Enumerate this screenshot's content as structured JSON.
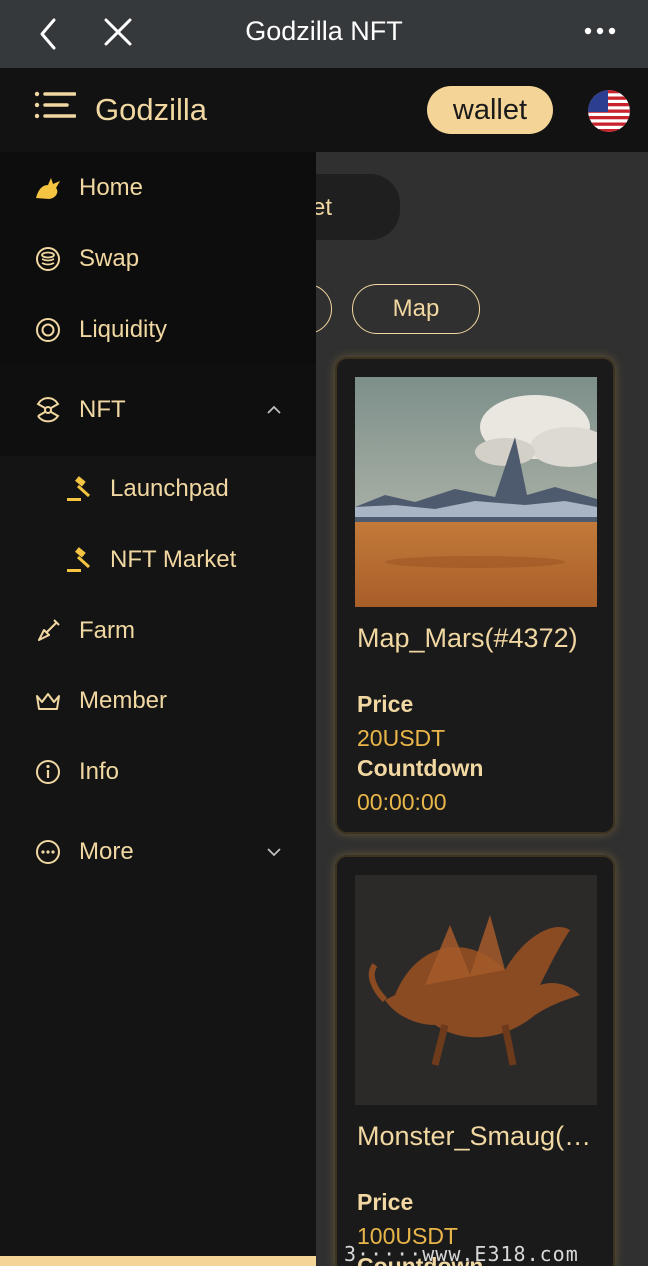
{
  "browser": {
    "title": "Godzilla NFT"
  },
  "header": {
    "brand": "Godzilla",
    "wallet_label": "wallet",
    "language_flag": "us-flag-icon"
  },
  "content": {
    "tab_partial": "ket",
    "filters": [
      {
        "label": ""
      },
      {
        "label": "Map"
      }
    ],
    "cards": [
      {
        "name": "Map_Mars(#4372)",
        "price_label": "Price",
        "price": "20USDT",
        "countdown_label": "Countdown",
        "countdown": "00:00:00"
      },
      {
        "name": "Monster_Smaug(…",
        "price_label": "Price",
        "price": "100USDT",
        "countdown_label": "Countdown"
      }
    ]
  },
  "drawer": {
    "items": [
      {
        "label": "Home",
        "icon": "dragon-icon"
      },
      {
        "label": "Swap",
        "icon": "coin-stack-icon"
      },
      {
        "label": "Liquidity",
        "icon": "target-icon"
      },
      {
        "label": "NFT",
        "icon": "radiation-icon",
        "expanded": true
      },
      {
        "label": "Launchpad",
        "icon": "gavel-icon",
        "sub": true
      },
      {
        "label": "NFT Market",
        "icon": "gavel-icon",
        "sub": true
      },
      {
        "label": "Farm",
        "icon": "shovel-icon"
      },
      {
        "label": "Member",
        "icon": "crown-icon"
      },
      {
        "label": "Info",
        "icon": "info-icon"
      },
      {
        "label": "More",
        "icon": "dots-circle-icon",
        "expanded": false
      }
    ]
  },
  "watermark": "3·····www.E318.com",
  "colors": {
    "accent": "#f1d7a1",
    "wallet_bg": "#f5d597",
    "price": "#eab64a",
    "drawer_bg": "#141414",
    "content_bg": "#303030"
  }
}
